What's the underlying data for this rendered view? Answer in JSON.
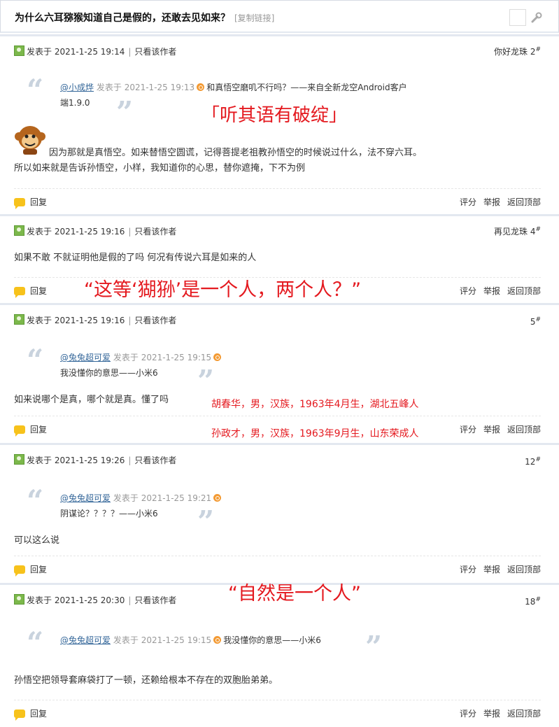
{
  "header": {
    "title": "为什么六耳猕猴知道自己是假的，还敢去见如来？",
    "copy_link": "[复制链接]"
  },
  "common": {
    "posted_prefix": "发表于",
    "only_author": "只看该作者",
    "reply": "回复",
    "rate": "评分",
    "report": "举报",
    "back_top": "返回顶部",
    "floor_mark": "#"
  },
  "posts": [
    {
      "date": "2021-1-25 19:14",
      "floor_name": "你好龙珠",
      "floor_no": "2",
      "quote": {
        "author": "@小成烨",
        "posted": "发表于",
        "date": "2021-1-25 19:13",
        "line1": "和真悟空磨叽不行吗？——来自全新龙空Android客户",
        "line2": "端1.9.0"
      },
      "body1": "因为那就是真悟空。如来替悟空圆谎，记得菩提老祖教孙悟空的时候说过什么，法不穿六耳。",
      "body2": "所以如来就是告诉孙悟空，小样，我知道你的心思，替你遮掩，下不为例"
    },
    {
      "date": "2021-1-25 19:16",
      "floor_name": "再见龙珠",
      "floor_no": "4",
      "body1": "如果不敢 不就证明他是假的了吗 何况有传说六耳是如来的人"
    },
    {
      "date": "2021-1-25 19:16",
      "floor_name": "",
      "floor_no": "5",
      "quote": {
        "author": "@兔兔超可爱",
        "posted": "发表于",
        "date": "2021-1-25 19:15",
        "line1": "我没懂你的意思——小米6"
      },
      "body1": "如来说哪个是真，哪个就是真。懂了吗"
    },
    {
      "date": "2021-1-25 19:26",
      "floor_name": "",
      "floor_no": "12",
      "quote": {
        "author": "@兔兔超可爱",
        "posted": "发表于",
        "date": "2021-1-25 19:21",
        "line1": "阴谋论？？？？——小米6"
      },
      "body1": "可以这么说"
    },
    {
      "date": "2021-1-25 20:30",
      "floor_name": "",
      "floor_no": "18",
      "quote": {
        "author": "@兔兔超可爱",
        "posted": "发表于",
        "date": "2021-1-25 19:15",
        "line1": "我没懂你的意思——小米6"
      },
      "body1": "孙悟空把领导套麻袋打了一顿，还赖给根本不存在的双胞胎弟弟。"
    }
  ],
  "overlays": {
    "a": "「听其语有破绽」",
    "b": "“这等‘猢狲’是一个人，两个人？”",
    "c": "胡春华，男，汉族，1963年4月生，湖北五峰人",
    "d": "孙政才，男，汉族，1963年9月生，山东荣成人",
    "e": "“自然是一个人”"
  },
  "colors": {
    "overlay_red": "#e4191f",
    "quote_author_blue": "#336699",
    "quote_mark_gray": "#c9d3de",
    "reply_icon_yellow": "#f7c21b",
    "user_icon_green": "#7cb84b",
    "back_icon_orange": "#f39a33"
  },
  "icons": [
    "user-icon",
    "reply-bubble-icon",
    "quote-open-icon",
    "quote-close-icon",
    "back-arrow-icon",
    "monkey-emoji-icon",
    "wrench-icon"
  ]
}
